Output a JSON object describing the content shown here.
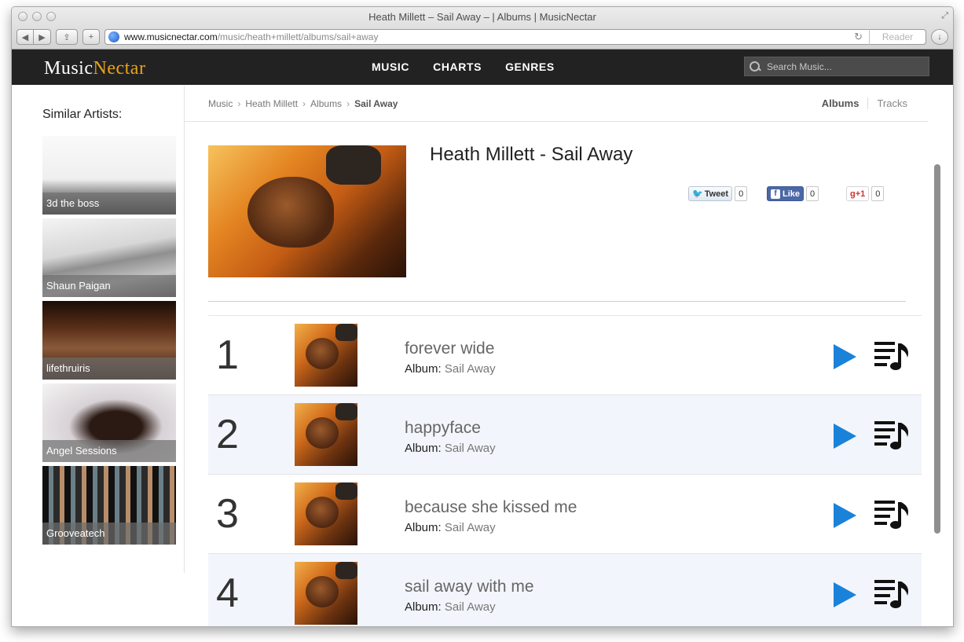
{
  "window": {
    "title": "Heath Millett – Sail Away – | Albums | MusicNectar",
    "url_host": "www.musicnectar.com",
    "url_path": "/music/heath+millett/albums/sail+away",
    "reader_label": "Reader"
  },
  "site": {
    "logo_part1": "Music",
    "logo_part2": "Nectar",
    "nav": [
      "MUSIC",
      "CHARTS",
      "GENRES"
    ],
    "search_placeholder": "Search Music...",
    "accent_color": "#e8a21b"
  },
  "sidebar": {
    "heading": "Similar Artists:",
    "artists": [
      "3d the boss",
      "Shaun Paigan",
      "lifethruiris",
      "Angel Sessions",
      "Grooveatech"
    ]
  },
  "breadcrumb": {
    "items": [
      "Music",
      "Heath Millett",
      "Albums"
    ],
    "separator": "›",
    "current": "Sail Away"
  },
  "view_tabs": [
    "Albums",
    "Tracks"
  ],
  "album": {
    "title": "Heath Millett - Sail Away"
  },
  "social": {
    "tweet_label": "Tweet",
    "tweet_count": "0",
    "like_label": "Like",
    "like_count": "0",
    "gplus_label": "+1",
    "gplus_count": "0"
  },
  "tracks": [
    {
      "num": "1",
      "name": "forever wide",
      "album_label": "Album:",
      "album": "Sail Away"
    },
    {
      "num": "2",
      "name": "happyface",
      "album_label": "Album:",
      "album": "Sail Away"
    },
    {
      "num": "3",
      "name": "because she kissed me",
      "album_label": "Album:",
      "album": "Sail Away"
    },
    {
      "num": "4",
      "name": "sail away with me",
      "album_label": "Album:",
      "album": "Sail Away"
    }
  ],
  "colors": {
    "play_button": "#1a82d8",
    "header_bg": "#222222",
    "alt_row": "#f2f5fb"
  }
}
